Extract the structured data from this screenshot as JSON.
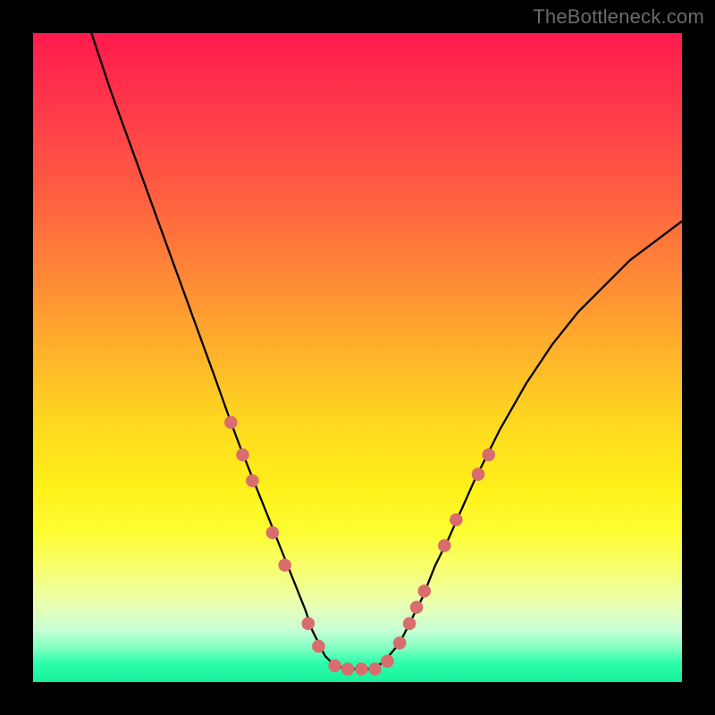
{
  "watermark": "TheBottleneck.com",
  "chart_data": {
    "type": "line",
    "title": "",
    "xlabel": "",
    "ylabel": "",
    "xlim": [
      0,
      100
    ],
    "ylim": [
      0,
      100
    ],
    "series": [
      {
        "name": "curve",
        "x": [
          9,
          12,
          16,
          20,
          24,
          28,
          30.5,
          32,
          34,
          36,
          38,
          40,
          42,
          43,
          44,
          45,
          46,
          48,
          50,
          52,
          54,
          56.5,
          58,
          60,
          62,
          64,
          68,
          72,
          76,
          80,
          84,
          88,
          92,
          96,
          100
        ],
        "y": [
          100,
          91,
          80,
          69,
          58,
          47,
          40,
          36,
          31,
          26,
          21,
          16,
          11,
          8,
          6,
          4,
          3,
          2,
          2,
          2,
          3,
          6,
          9,
          13,
          18,
          22,
          31,
          39,
          46,
          52,
          57,
          61,
          65,
          68,
          71
        ]
      }
    ],
    "markers": {
      "color": "#d96d6d",
      "radius_pct": 1.0,
      "points": [
        {
          "x": 30.5,
          "y": 40
        },
        {
          "x": 32.3,
          "y": 35
        },
        {
          "x": 33.8,
          "y": 31
        },
        {
          "x": 36.9,
          "y": 23
        },
        {
          "x": 38.8,
          "y": 18
        },
        {
          "x": 42.4,
          "y": 9
        },
        {
          "x": 44.0,
          "y": 5.5
        },
        {
          "x": 46.5,
          "y": 2.5
        },
        {
          "x": 48.5,
          "y": 2
        },
        {
          "x": 50.6,
          "y": 2
        },
        {
          "x": 52.7,
          "y": 2
        },
        {
          "x": 54.6,
          "y": 3.2
        },
        {
          "x": 56.5,
          "y": 6
        },
        {
          "x": 58.0,
          "y": 9
        },
        {
          "x": 59.1,
          "y": 11.5
        },
        {
          "x": 60.3,
          "y": 14
        },
        {
          "x": 63.4,
          "y": 21
        },
        {
          "x": 65.2,
          "y": 25
        },
        {
          "x": 68.6,
          "y": 32
        },
        {
          "x": 70.2,
          "y": 35
        }
      ]
    },
    "background": {
      "type": "vertical-gradient",
      "stops": [
        {
          "pos": 0,
          "color": "#ff1a4d"
        },
        {
          "pos": 50,
          "color": "#ffb52a"
        },
        {
          "pos": 77,
          "color": "#fdfd33"
        },
        {
          "pos": 95,
          "color": "#7affc0"
        },
        {
          "pos": 100,
          "color": "#17f09a"
        }
      ]
    }
  }
}
